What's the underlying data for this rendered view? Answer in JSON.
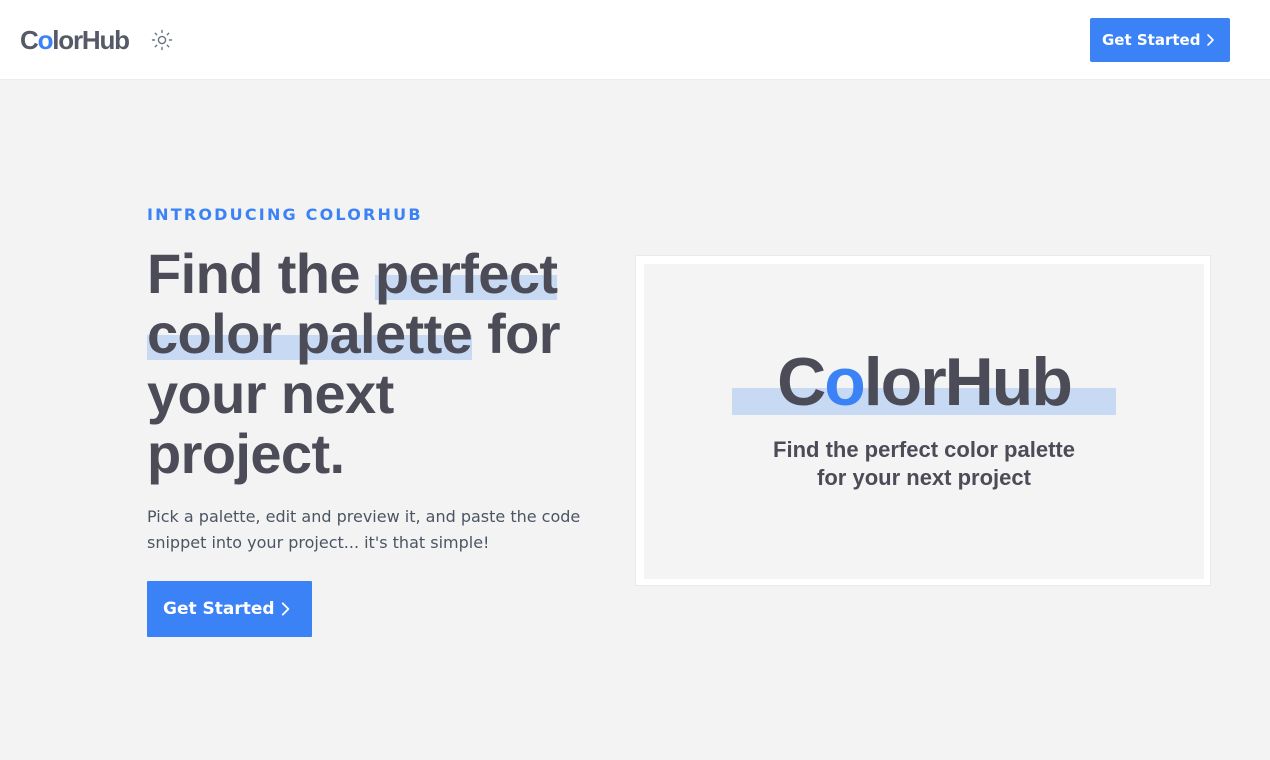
{
  "header": {
    "logo": {
      "prefix": "C",
      "accent": "o",
      "suffix": "lorHub"
    },
    "theme_toggle_icon": "sun-icon",
    "cta_label": "Get Started",
    "cta_icon": "chevron-right-icon"
  },
  "hero": {
    "eyebrow": "INTRODUCING COLORHUB",
    "headline": {
      "line1_plain": "Find the ",
      "line1_highlight": "perfect",
      "line2_highlight": "color palette",
      "line2_plain": " for",
      "line3": "your next",
      "line4": "project."
    },
    "subtext": "Pick a palette, edit and preview it, and paste the code snippet into your project... it's that simple!",
    "cta_label": "Get Started",
    "cta_icon": "chevron-right-icon"
  },
  "preview": {
    "logo": {
      "prefix": "C",
      "accent": "o",
      "suffix": "lorHub"
    },
    "tagline_line1": "Find the perfect color palette",
    "tagline_line2": "for your next project"
  },
  "colors": {
    "accent": "#3b82f6",
    "highlight": "#c8d9f4",
    "heading": "#4b4c57",
    "body_text": "#4b5563",
    "page_bg": "#f3f3f3",
    "header_bg": "#ffffff"
  }
}
